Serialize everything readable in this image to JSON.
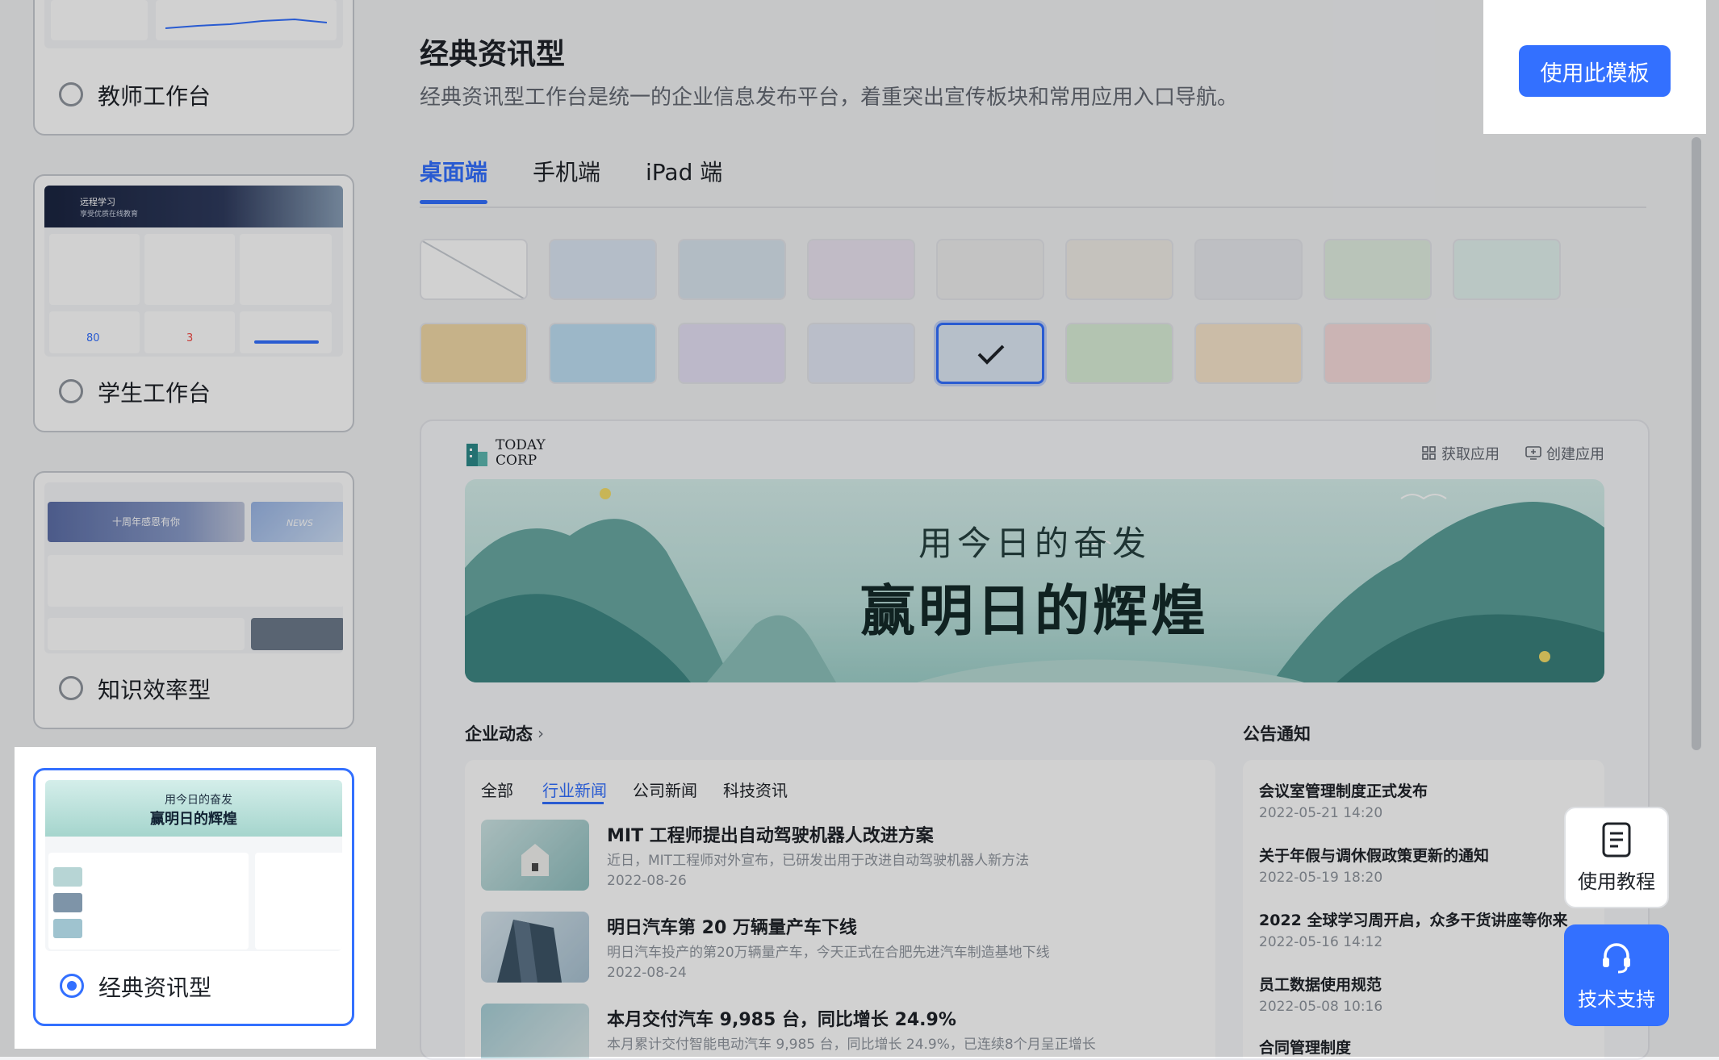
{
  "sidebar": {
    "templates": [
      {
        "label": "教师工作台",
        "selected": false
      },
      {
        "label": "学生工作台",
        "selected": false,
        "thumb": {
          "banner_line1": "远程学习",
          "banner_line2": "享受优质在线教育",
          "stat1": "80",
          "stat2": "3"
        }
      },
      {
        "label": "知识效率型",
        "selected": false,
        "thumb": {
          "banner": "十周年感恩有你",
          "news": "NEWS"
        }
      },
      {
        "label": "经典资讯型",
        "selected": true,
        "thumb": {
          "line1": "用今日的奋发",
          "line2": "赢明日的辉煌"
        }
      }
    ]
  },
  "header": {
    "title": "经典资讯型",
    "description": "经典资讯型工作台是统一的企业信息发布平台，着重突出宣传板块和常用应用入口导航。",
    "use_button": "使用此模板"
  },
  "tabs": [
    {
      "label": "桌面端",
      "active": true
    },
    {
      "label": "手机端",
      "active": false
    },
    {
      "label": "iPad 端",
      "active": false
    }
  ],
  "swatches": {
    "selected_index": 13,
    "colors": [
      "#ffffff",
      "#dce7f5",
      "#d9e6ef",
      "#ece4f2",
      "#eeeeee",
      "#f1ede7",
      "#e8e9ee",
      "#e2efe2",
      "#e3f3f0",
      "#f2d9a8",
      "#bfe0f5",
      "#e6e1f6",
      "#e3e8f6",
      "#dfeaf6",
      "#dbf0d8",
      "#f8e6cc",
      "#f8dcdc"
    ]
  },
  "preview": {
    "logo_line1": "TODAY",
    "logo_line2": "CORP",
    "get_apps": "获取应用",
    "create_app": "创建应用",
    "banner_line1": "用今日的奋发",
    "banner_line2": "赢明日的辉煌",
    "news_section": "企业动态",
    "notice_section": "公告通知",
    "news_tabs": [
      {
        "label": "全部",
        "active": false
      },
      {
        "label": "行业新闻",
        "active": true
      },
      {
        "label": "公司新闻",
        "active": false
      },
      {
        "label": "科技资讯",
        "active": false
      }
    ],
    "news": [
      {
        "title": "MIT 工程师提出自动驾驶机器人改进方案",
        "sub": "近日，MIT工程师对外宣布，已研发出用于改进自动驾驶机器人新方法",
        "date": "2022-08-26"
      },
      {
        "title": "明日汽车第 20 万辆量产车下线",
        "sub": "明日汽车投产的第20万辆量产车，今天正式在合肥先进汽车制造基地下线",
        "date": "2022-08-24"
      },
      {
        "title": "本月交付汽车 9,985 台，同比增长 24.9%",
        "sub": "本月累计交付智能电动汽车 9,985 台，同比增长 24.9%，已连续8个月呈正增长",
        "date": ""
      }
    ],
    "notices": [
      {
        "title": "会议室管理制度正式发布",
        "date": "2022-05-21 14:20"
      },
      {
        "title": "关于年假与调休假政策更新的通知",
        "date": "2022-05-19 18:20"
      },
      {
        "title": "2022 全球学习周开启，众多干货讲座等你来",
        "date": "2022-05-16  14:12"
      },
      {
        "title": "员工数据使用规范",
        "date": "2022-05-08 10:16"
      },
      {
        "title": "合同管理制度",
        "date": ""
      }
    ]
  },
  "floating": {
    "tutorial": "使用教程",
    "support": "技术支持"
  }
}
